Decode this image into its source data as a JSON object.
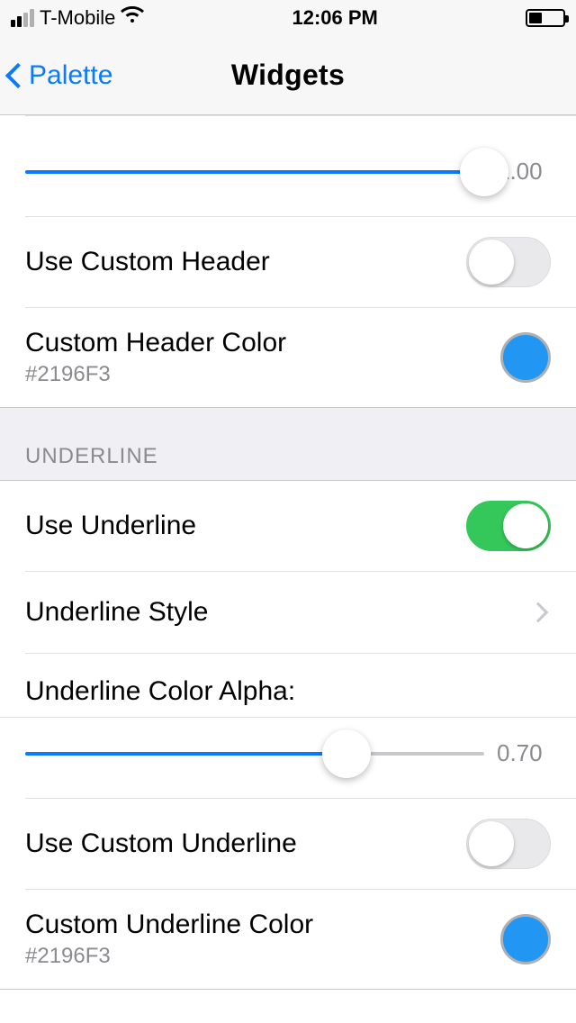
{
  "status": {
    "carrier": "T-Mobile",
    "time": "12:06 PM"
  },
  "nav": {
    "back_label": "Palette",
    "title": "Widgets"
  },
  "section1": {
    "slider1_value": "1.00",
    "slider1_pct": 100,
    "use_custom_header": {
      "label": "Use Custom Header",
      "on": false
    },
    "custom_header_color": {
      "label": "Custom Header Color",
      "hex": "#2196F3"
    }
  },
  "section_underline": {
    "header": "UNDERLINE",
    "use_underline": {
      "label": "Use Underline",
      "on": true
    },
    "underline_style": {
      "label": "Underline Style"
    },
    "underline_alpha": {
      "label": "Underline Color Alpha:",
      "value": "0.70",
      "pct": 70
    },
    "use_custom_underline": {
      "label": "Use Custom Underline",
      "on": false
    },
    "custom_underline_color": {
      "label": "Custom Underline Color",
      "hex": "#2196F3"
    }
  }
}
